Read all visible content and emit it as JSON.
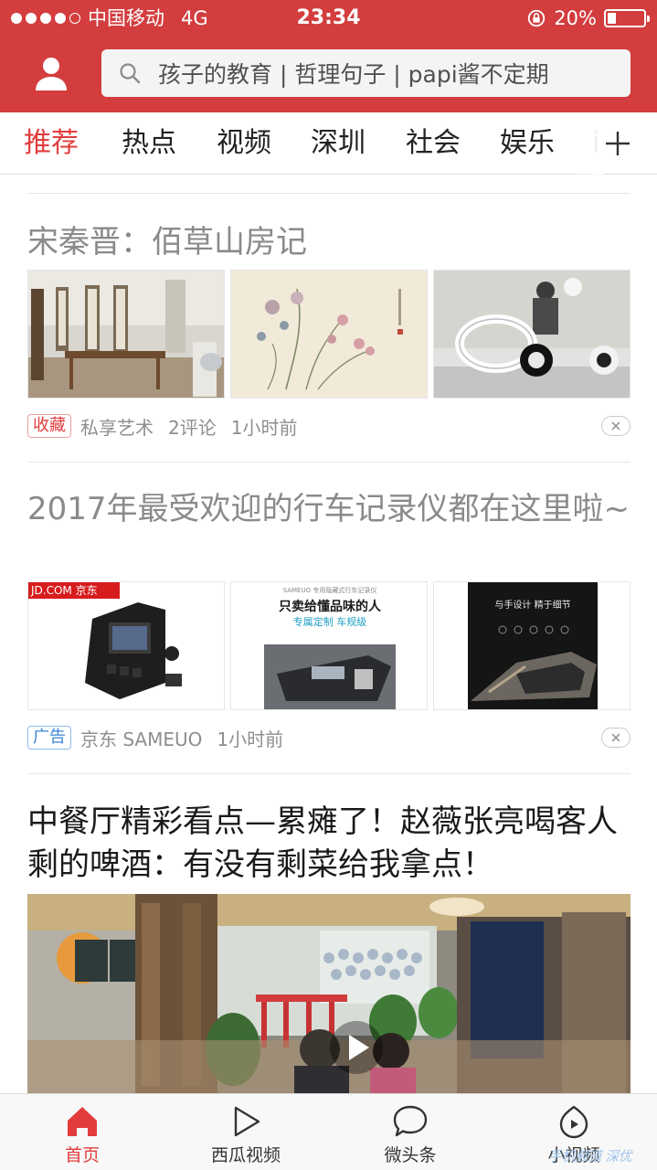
{
  "status_bar": {
    "carrier": "中国移动",
    "network": "4G",
    "time": "23:34",
    "battery": "20%"
  },
  "search": {
    "placeholder": "孩子的教育 | 哲理句子 | papi酱不定期"
  },
  "tabs": [
    "推荐",
    "热点",
    "视频",
    "深圳",
    "社会",
    "娱乐"
  ],
  "tab_partial": "i",
  "active_tab": "推荐",
  "feed": [
    {
      "title": "宋秦晋：佰草山房记",
      "tag": "收藏",
      "source": "私享艺术",
      "comments": "2评论",
      "time": "1小时前"
    },
    {
      "title": "2017年最受欢迎的行车记录仪都在这里啦~",
      "tag": "广告",
      "source": "京东 SAMEUO",
      "time": "1小时前",
      "image_texts": {
        "jd": "JD.COM 京东",
        "brand_small": "SAMEUO 专用隐藏式行车记录仪",
        "slogan": "只卖给懂品味的人",
        "sub": "专属定制 车规级",
        "dark": "与手设计 精于细节"
      }
    },
    {
      "title": "中餐厅精彩看点—累瘫了！赵薇张亮喝客人剩的啤酒：有没有剩菜给我拿点！"
    }
  ],
  "bottom_nav": [
    {
      "label": "首页",
      "icon": "home-icon",
      "active": true
    },
    {
      "label": "西瓜视频",
      "icon": "play-icon",
      "active": false
    },
    {
      "label": "微头条",
      "icon": "chat-bubble-icon",
      "active": false
    },
    {
      "label": "小视频",
      "icon": "small-video-icon",
      "active": false
    }
  ],
  "watermark": "手机频道 深优",
  "colors": {
    "brand_red": "#d33d3e",
    "active_red": "#e23c3c",
    "ad_blue": "#3a86d6"
  }
}
